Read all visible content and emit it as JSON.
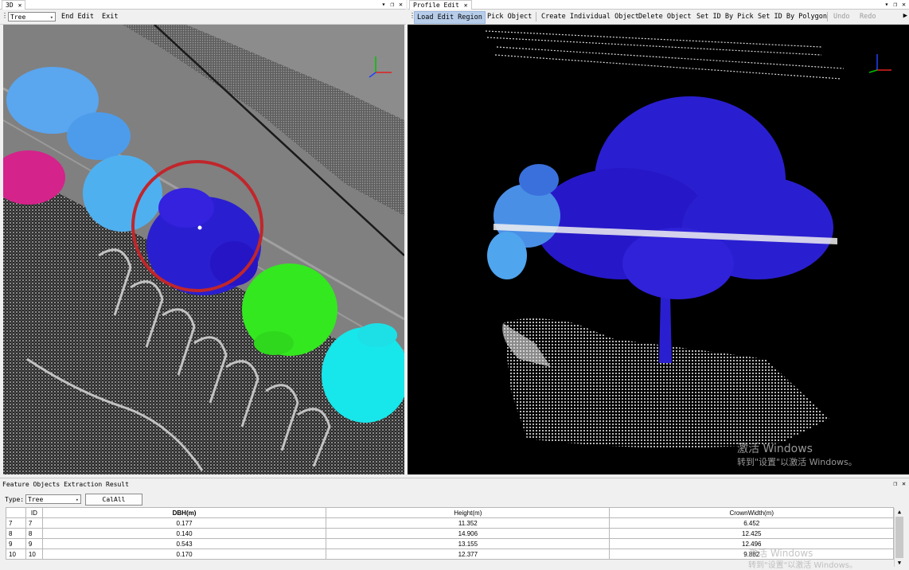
{
  "left_panel": {
    "tab_label": "3D",
    "toolbar": {
      "type_select": "Tree",
      "end_edit": "End Edit",
      "exit": "Exit"
    }
  },
  "right_panel": {
    "tab_label": "Profile Edit",
    "toolbar": {
      "load_edit_region": "Load Edit Region",
      "pick_object": "Pick Object",
      "create_individual_object": "Create Individual Object",
      "delete_object": "Delete Object",
      "set_id_by_pick": "Set ID By Pick",
      "set_id_by_polygon": "Set ID By Polygon",
      "undo": "Undo",
      "redo": "Redo"
    }
  },
  "watermark": {
    "line1": "激活 Windows",
    "line2": "转到\"设置\"以激活 Windows。"
  },
  "result_panel": {
    "title": "Feature Objects Extraction Result",
    "type_label": "Type:",
    "type_value": "Tree",
    "calall_button": "CalAll",
    "columns": [
      "ID",
      "DBH(m)",
      "Height(m)",
      "CrownWidth(m)"
    ],
    "rows": [
      {
        "row": "7",
        "id": "7",
        "dbh": "0.177",
        "height": "11.352",
        "crown": "6.452"
      },
      {
        "row": "8",
        "id": "8",
        "dbh": "0.140",
        "height": "14.906",
        "crown": "12.425"
      },
      {
        "row": "9",
        "id": "9",
        "dbh": "0.543",
        "height": "13.155",
        "crown": "12.496"
      },
      {
        "row": "10",
        "id": "10",
        "dbh": "0.170",
        "height": "12.377",
        "crown": "9.882"
      }
    ]
  },
  "colors": {
    "tree_selected": "#2a1fd0",
    "tree_light_blue": "#5aa6ef",
    "tree_green": "#33e81f",
    "tree_cyan": "#17e6ea",
    "tree_magenta": "#d4238a",
    "selection_circle": "#c0262b"
  }
}
